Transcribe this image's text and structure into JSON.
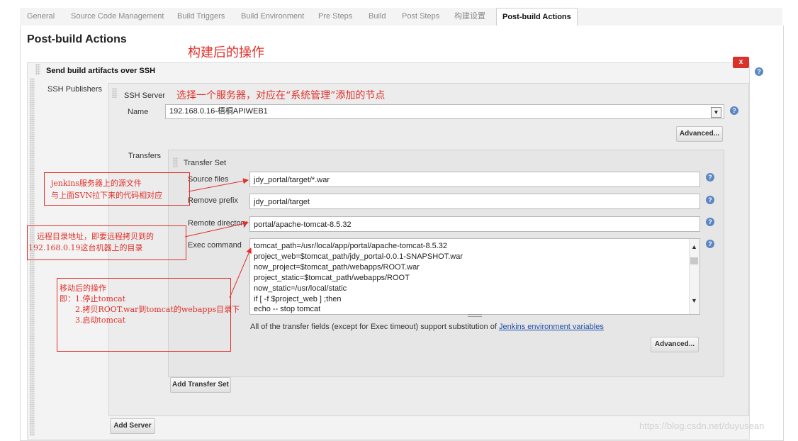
{
  "tabs": [
    {
      "label": "General",
      "active": false
    },
    {
      "label": "Source Code Management",
      "active": false
    },
    {
      "label": "Build Triggers",
      "active": false
    },
    {
      "label": "Build Environment",
      "active": false
    },
    {
      "label": "Pre Steps",
      "active": false
    },
    {
      "label": "Build",
      "active": false
    },
    {
      "label": "Post Steps",
      "active": false
    },
    {
      "label": "构建设置",
      "active": false
    },
    {
      "label": "Post-build Actions",
      "active": true
    }
  ],
  "page": {
    "title": "Post-build Actions",
    "step_title": "Send build artifacts over SSH",
    "close_label": "x"
  },
  "ssh": {
    "publishers_label": "SSH Publishers",
    "server_label": "SSH Server",
    "name_label": "Name",
    "name_value": "192.168.0.16-梧桐APIWEB1",
    "advanced_label": "Advanced..."
  },
  "transfers": {
    "label": "Transfers",
    "set_label": "Transfer Set",
    "source_files_label": "Source files",
    "source_files_value": "jdy_portal/target/*.war",
    "remove_prefix_label": "Remove prefix",
    "remove_prefix_value": "jdy_portal/target",
    "remote_dir_label": "Remote directory",
    "remote_dir_value": "portal/apache-tomcat-8.5.32",
    "exec_label": "Exec command",
    "exec_lines": [
      "tomcat_path=/usr/local/app/portal/apache-tomcat-8.5.32",
      "project_web=$tomcat_path/jdy_portal-0.0.1-SNAPSHOT.war",
      "now_project=$tomcat_path/webapps/ROOT.war",
      "project_static=$tomcat_path/webapps/ROOT",
      "now_static=/usr/local/static",
      "if [ -f $project_web ] ;then",
      "echo -- stop tomcat"
    ],
    "note_prefix": "All of the transfer fields (except for Exec timeout) support substitution of ",
    "note_link": "Jenkins environment variables",
    "advanced_label": "Advanced...",
    "add_transfer_label": "Add Transfer Set"
  },
  "add_server_label": "Add Server",
  "annotations": {
    "post_build": "构建后的操作",
    "select_server": "选择一个服务器，对应在“系统管理”添加的节点",
    "source_line1": "jenkins服务器上的源文件",
    "source_line2": "与上面SVN拉下来的代码相对应",
    "remote_line1": "远程目录地址，即要远程拷贝到的",
    "remote_line2": "192.168.0.19这台机器上的目录",
    "exec_line1": "移动后的操作",
    "exec_line2": "即：1.停止tomcat",
    "exec_line3": "2.拷贝ROOT.war到tomcat的webapps目录下",
    "exec_line4": "3.启动tomcat"
  },
  "watermark": "https://blog.csdn.net/duyusean",
  "colors": {
    "annotation_red": "#e0302a",
    "link_blue": "#1f4fa8",
    "close_red": "#d8322b",
    "help_blue": "#5b86c4"
  }
}
